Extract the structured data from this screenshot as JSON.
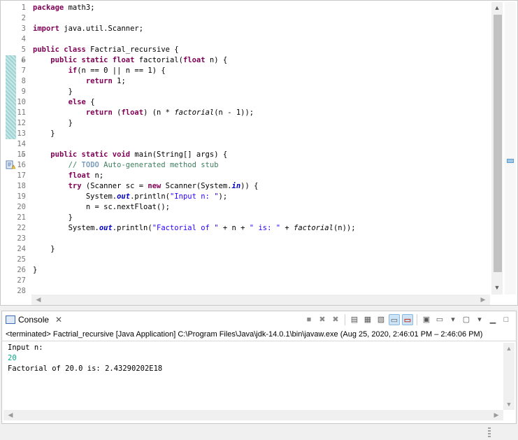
{
  "editor": {
    "lines": [
      {
        "n": "1",
        "html": "<span class=\"kw\">package</span> math3;"
      },
      {
        "n": "2",
        "html": ""
      },
      {
        "n": "3",
        "html": "<span class=\"kw\">import</span> java.util.Scanner;"
      },
      {
        "n": "4",
        "html": ""
      },
      {
        "n": "5",
        "html": "<span class=\"kw\">public class</span> Factrial_recursive {"
      },
      {
        "n": "6",
        "html": "    <span class=\"kw\">public static float</span> factorial(<span class=\"kw\">float</span> n) {",
        "fold": true
      },
      {
        "n": "7",
        "html": "        <span class=\"kw\">if</span>(n == 0 || n == 1) {"
      },
      {
        "n": "8",
        "html": "            <span class=\"kw\">return</span> 1;"
      },
      {
        "n": "9",
        "html": "        }"
      },
      {
        "n": "10",
        "html": "        <span class=\"kw\">else</span> {"
      },
      {
        "n": "11",
        "html": "            <span class=\"kw\">return</span> (<span class=\"kw\">float</span>) (n * <span class=\"it\">factorial</span>(n - 1));"
      },
      {
        "n": "12",
        "html": "        }"
      },
      {
        "n": "13",
        "html": "    }"
      },
      {
        "n": "14",
        "html": ""
      },
      {
        "n": "15",
        "html": "    <span class=\"kw\">public static void</span> main(String[] args) {",
        "fold": true
      },
      {
        "n": "16",
        "html": "        <span class=\"cm\">// <span class=\"todo\">TODO</span> Auto-generated method stub</span>"
      },
      {
        "n": "17",
        "html": "        <span class=\"kw\">float</span> n;"
      },
      {
        "n": "18",
        "html": "        <span class=\"kw\">try</span> (Scanner sc = <span class=\"kw\">new</span> Scanner(System.<span class=\"fld\">in</span>)) {"
      },
      {
        "n": "19",
        "html": "            System.<span class=\"fld\">out</span>.println(<span class=\"st\">\"Input n: \"</span>);"
      },
      {
        "n": "20",
        "html": "            n = sc.nextFloat();"
      },
      {
        "n": "21",
        "html": "        }"
      },
      {
        "n": "22",
        "html": "        System.<span class=\"fld\">out</span>.println(<span class=\"st\">\"Factorial of \"</span> + n + <span class=\"st\">\" is: \"</span> + <span class=\"it\">factorial</span>(n));"
      },
      {
        "n": "23",
        "html": ""
      },
      {
        "n": "24",
        "html": "    }"
      },
      {
        "n": "25",
        "html": ""
      },
      {
        "n": "26",
        "html": "}"
      },
      {
        "n": "27",
        "html": ""
      },
      {
        "n": "28",
        "html": ""
      }
    ]
  },
  "console": {
    "tab_label": "Console",
    "close_glyph": "✕",
    "terminated": "<terminated> Factrial_recursive [Java Application] C:\\Program Files\\Java\\jdk-14.0.1\\bin\\javaw.exe  (Aug 25, 2020, 2:46:01 PM – 2:46:06 PM)",
    "output": [
      {
        "text": "Input n:",
        "kind": "out"
      },
      {
        "text": "20",
        "kind": "input"
      },
      {
        "text": "Factorial of 20.0 is: 2.43290202E18",
        "kind": "out"
      }
    ]
  },
  "colors": {
    "keyword": "#7f0055",
    "comment": "#3f7f5f",
    "string": "#2a00ff",
    "field": "#0000c0",
    "console_input": "#00a88a"
  }
}
